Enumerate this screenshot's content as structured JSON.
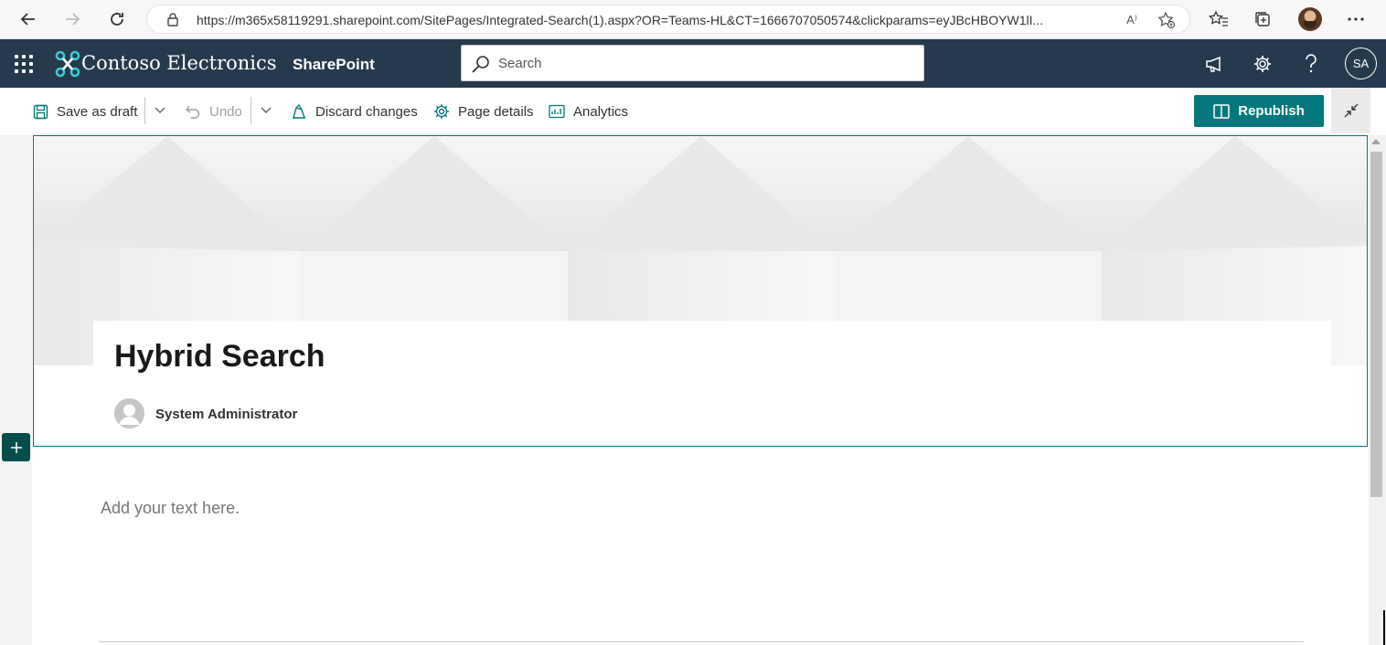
{
  "browser": {
    "url": "https://m365x58119291.sharepoint.com/SitePages/Integrated-Search(1).aspx?OR=Teams-HL&CT=1666707050574&clickparams=eyJBcHBOYW1lI...",
    "read_aloud_label": "A⁾"
  },
  "suite": {
    "brand_name": "Contoso Electronics",
    "site_name": "SharePoint",
    "search_placeholder": "Search",
    "user_initials": "SA"
  },
  "command_bar": {
    "save_label": "Save as draft",
    "undo_label": "Undo",
    "discard_label": "Discard changes",
    "details_label": "Page details",
    "analytics_label": "Analytics",
    "republish_label": "Republish"
  },
  "page": {
    "title": "Hybrid Search",
    "author": "System Administrator",
    "text_placeholder": "Add your text here."
  },
  "colors": {
    "suite_bar": "#263a4d",
    "accent": "#03787c",
    "add_button": "#054d4a"
  }
}
